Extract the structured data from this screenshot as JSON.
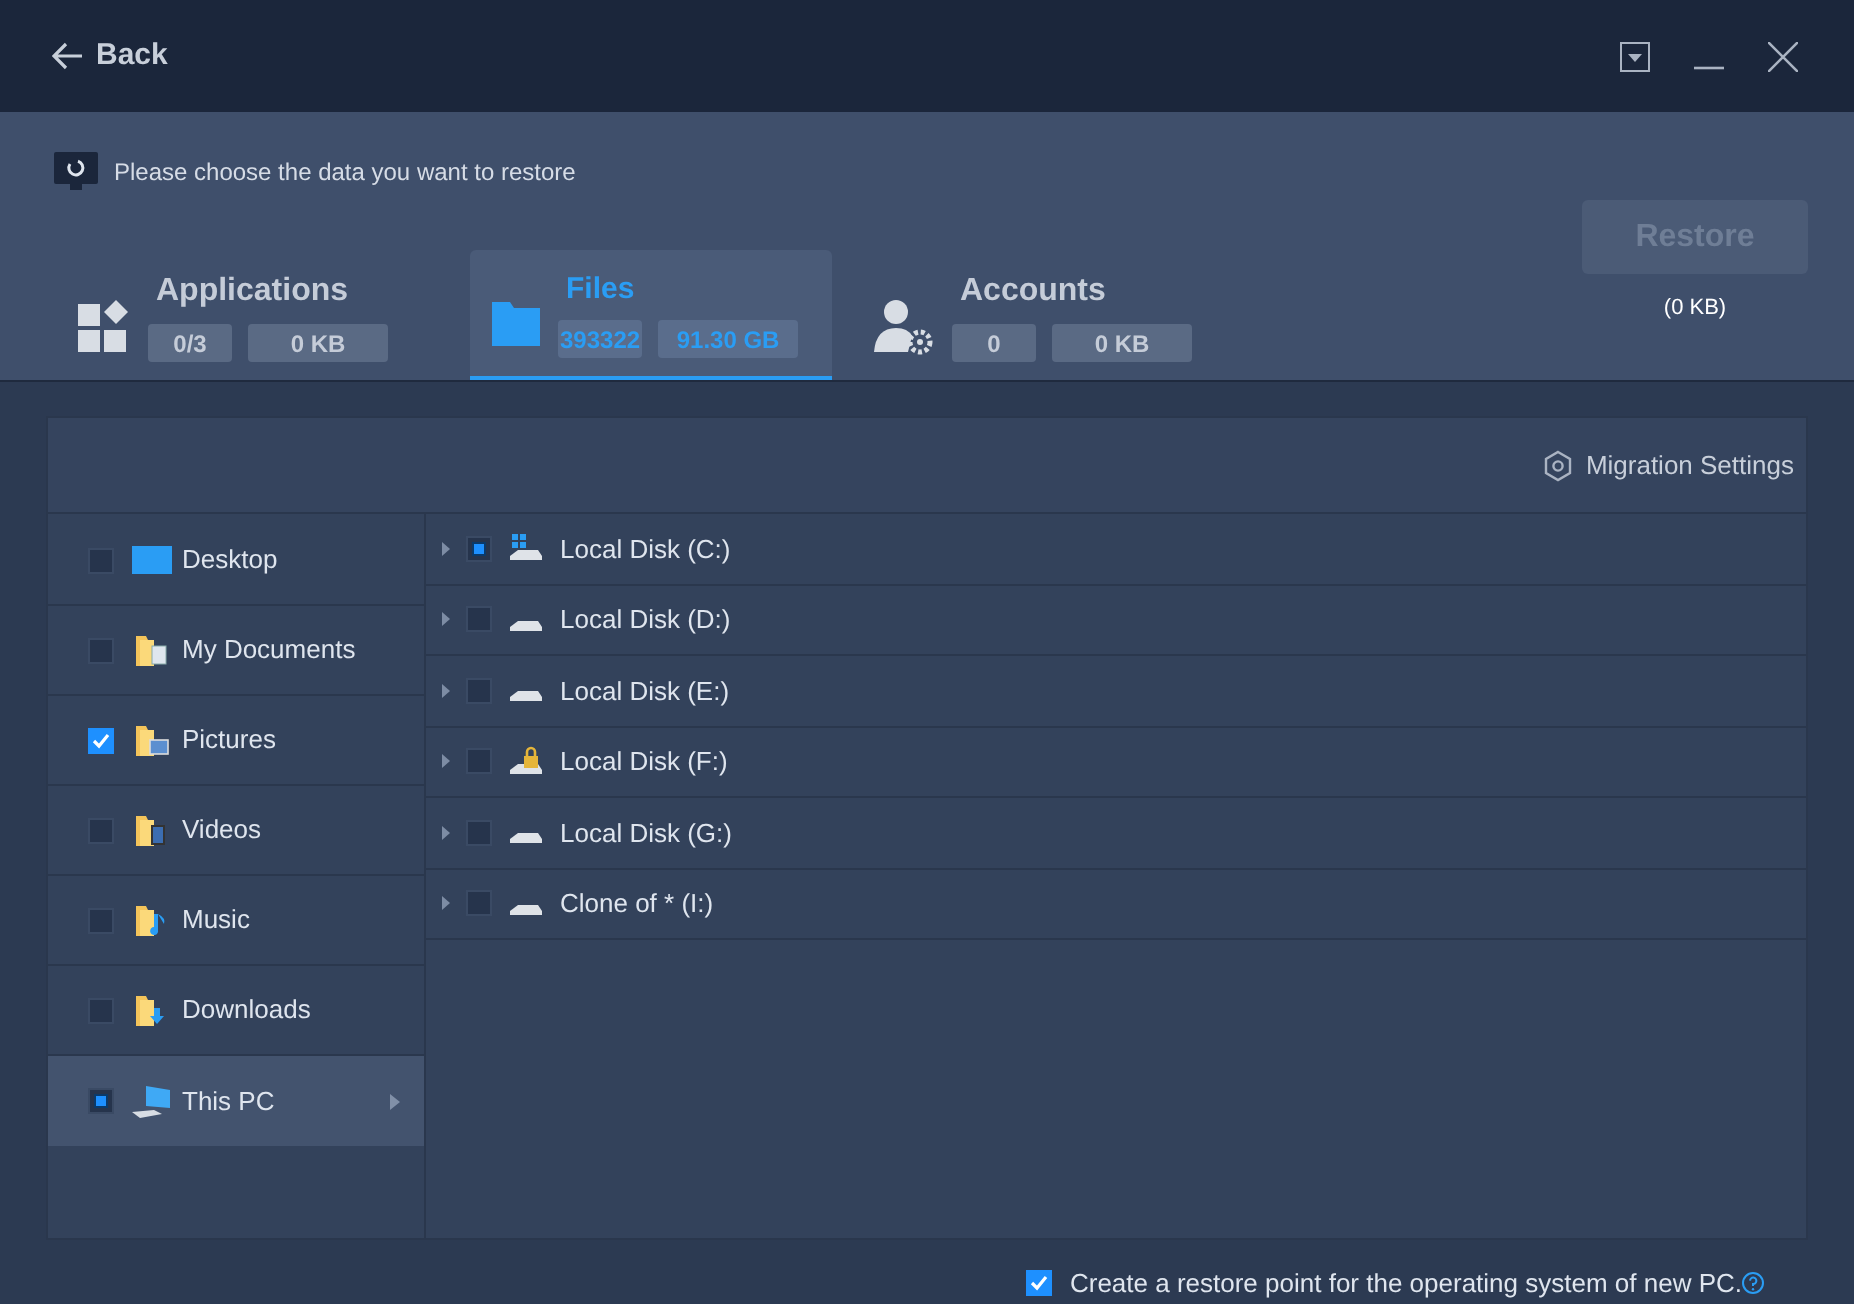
{
  "top_bar": {
    "back": "Back"
  },
  "prompt": "Please choose the data you want to restore",
  "tabs": [
    {
      "label": "Applications",
      "count": "0/3",
      "size": "0 KB",
      "selected": false,
      "kind": "apps"
    },
    {
      "label": "Files",
      "count": "393322",
      "size": "91.30 GB",
      "selected": true,
      "kind": "files"
    },
    {
      "label": "Accounts",
      "count": "0",
      "size": "0 KB",
      "selected": false,
      "kind": "accounts"
    }
  ],
  "restore": {
    "label": "Restore",
    "disabled": true,
    "size": "(0 KB)"
  },
  "migration_settings": "Migration Settings",
  "folders": [
    {
      "label": "Desktop",
      "checked": false,
      "partial": false,
      "kind": "desktop",
      "selected": false
    },
    {
      "label": "My Documents",
      "checked": false,
      "partial": false,
      "kind": "documents",
      "selected": false
    },
    {
      "label": "Pictures",
      "checked": true,
      "partial": false,
      "kind": "pictures",
      "selected": false
    },
    {
      "label": "Videos",
      "checked": false,
      "partial": false,
      "kind": "videos",
      "selected": false
    },
    {
      "label": "Music",
      "checked": false,
      "partial": false,
      "kind": "music",
      "selected": false
    },
    {
      "label": "Downloads",
      "checked": false,
      "partial": false,
      "kind": "downloads",
      "selected": false
    },
    {
      "label": "This PC",
      "checked": false,
      "partial": true,
      "kind": "pc",
      "selected": true
    }
  ],
  "drives": [
    {
      "label": "Local Disk (C:)",
      "checked": false,
      "partial": true,
      "kind": "system"
    },
    {
      "label": "Local Disk (D:)",
      "checked": false,
      "partial": false,
      "kind": "disk"
    },
    {
      "label": "Local Disk (E:)",
      "checked": false,
      "partial": false,
      "kind": "disk"
    },
    {
      "label": "Local Disk (F:)",
      "checked": false,
      "partial": false,
      "kind": "locked"
    },
    {
      "label": "Local Disk (G:)",
      "checked": false,
      "partial": false,
      "kind": "disk"
    },
    {
      "label": "Clone of * (I:)",
      "checked": false,
      "partial": false,
      "kind": "disk"
    }
  ],
  "restore_point": {
    "label": "Create a restore point for the operating system of new PC.",
    "checked": true
  }
}
